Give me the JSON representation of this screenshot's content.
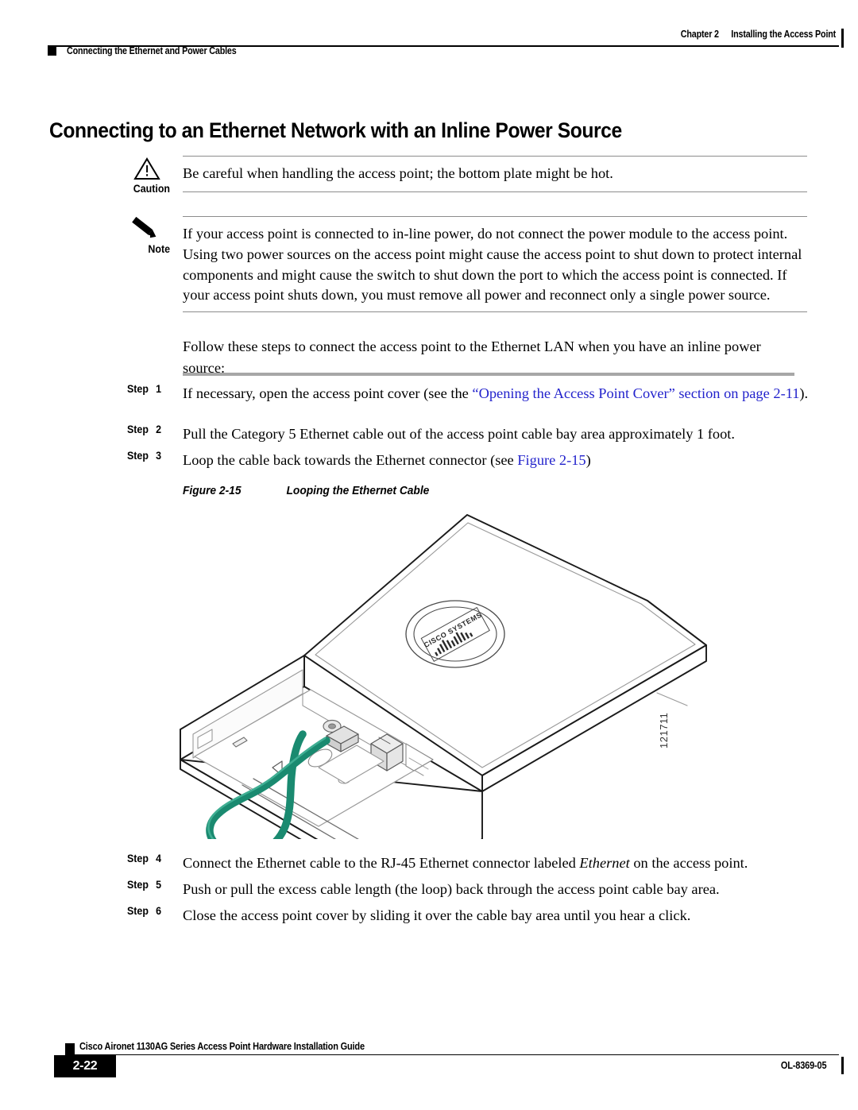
{
  "header": {
    "chapter_number": "Chapter 2",
    "chapter_title": "Installing the Access Point",
    "section_title": "Connecting the Ethernet and Power Cables"
  },
  "title": "Connecting to an Ethernet Network with an Inline Power Source",
  "caution": {
    "label": "Caution",
    "icon": "warning-triangle-icon",
    "text": "Be careful when handling the access point; the bottom plate might be hot."
  },
  "note": {
    "label": "Note",
    "icon": "pencil-icon",
    "text": "If your access point is connected to in-line power, do not connect the power module to the access point. Using two power sources on the access point might cause the access point to shut down to protect internal components and might cause the switch to shut down the port to which the access point is connected. If your access point shuts down, you must remove all power and reconnect only a single power source."
  },
  "intro": "Follow these steps to connect the access point to the Ethernet LAN when you have an inline power source:",
  "steps": [
    {
      "label": "Step",
      "number": "1",
      "text_before": "If necessary, open the access point cover (see the ",
      "link_text": "“Opening the Access Point Cover” section on page 2-11",
      "text_after": ")."
    },
    {
      "label": "Step",
      "number": "2",
      "text_before": "Pull the Category 5 Ethernet cable out of the access point cable bay area approximately 1 foot.",
      "link_text": "",
      "text_after": ""
    },
    {
      "label": "Step",
      "number": "3",
      "text_before": "Loop the cable back towards the Ethernet connector (see ",
      "link_text": "Figure 2-15",
      "text_after": ")"
    },
    {
      "label": "Step",
      "number": "4",
      "text_before": "Connect the Ethernet cable to the RJ-45 Ethernet connector labeled ",
      "italic_text": "Ethernet",
      "text_after": " on the access point."
    },
    {
      "label": "Step",
      "number": "5",
      "text_before": "Push or pull the excess cable length (the loop) back through the access point cable bay area.",
      "link_text": "",
      "text_after": ""
    },
    {
      "label": "Step",
      "number": "6",
      "text_before": "Close the access point cover by sliding it over the cable bay area until you hear a click.",
      "link_text": "",
      "text_after": ""
    }
  ],
  "figure": {
    "number": "Figure 2-15",
    "caption": "Looping the Ethernet Cable",
    "artwork_id": "121711",
    "logo_text": "CISCO SYSTEMS",
    "cable_color": "#1a8a70",
    "line_color": "#1a1a1a"
  },
  "footer": {
    "guide_title": "Cisco Aironet 1130AG Series Access Point Hardware Installation Guide",
    "page_number": "2-22",
    "document_id": "OL-8369-05"
  }
}
